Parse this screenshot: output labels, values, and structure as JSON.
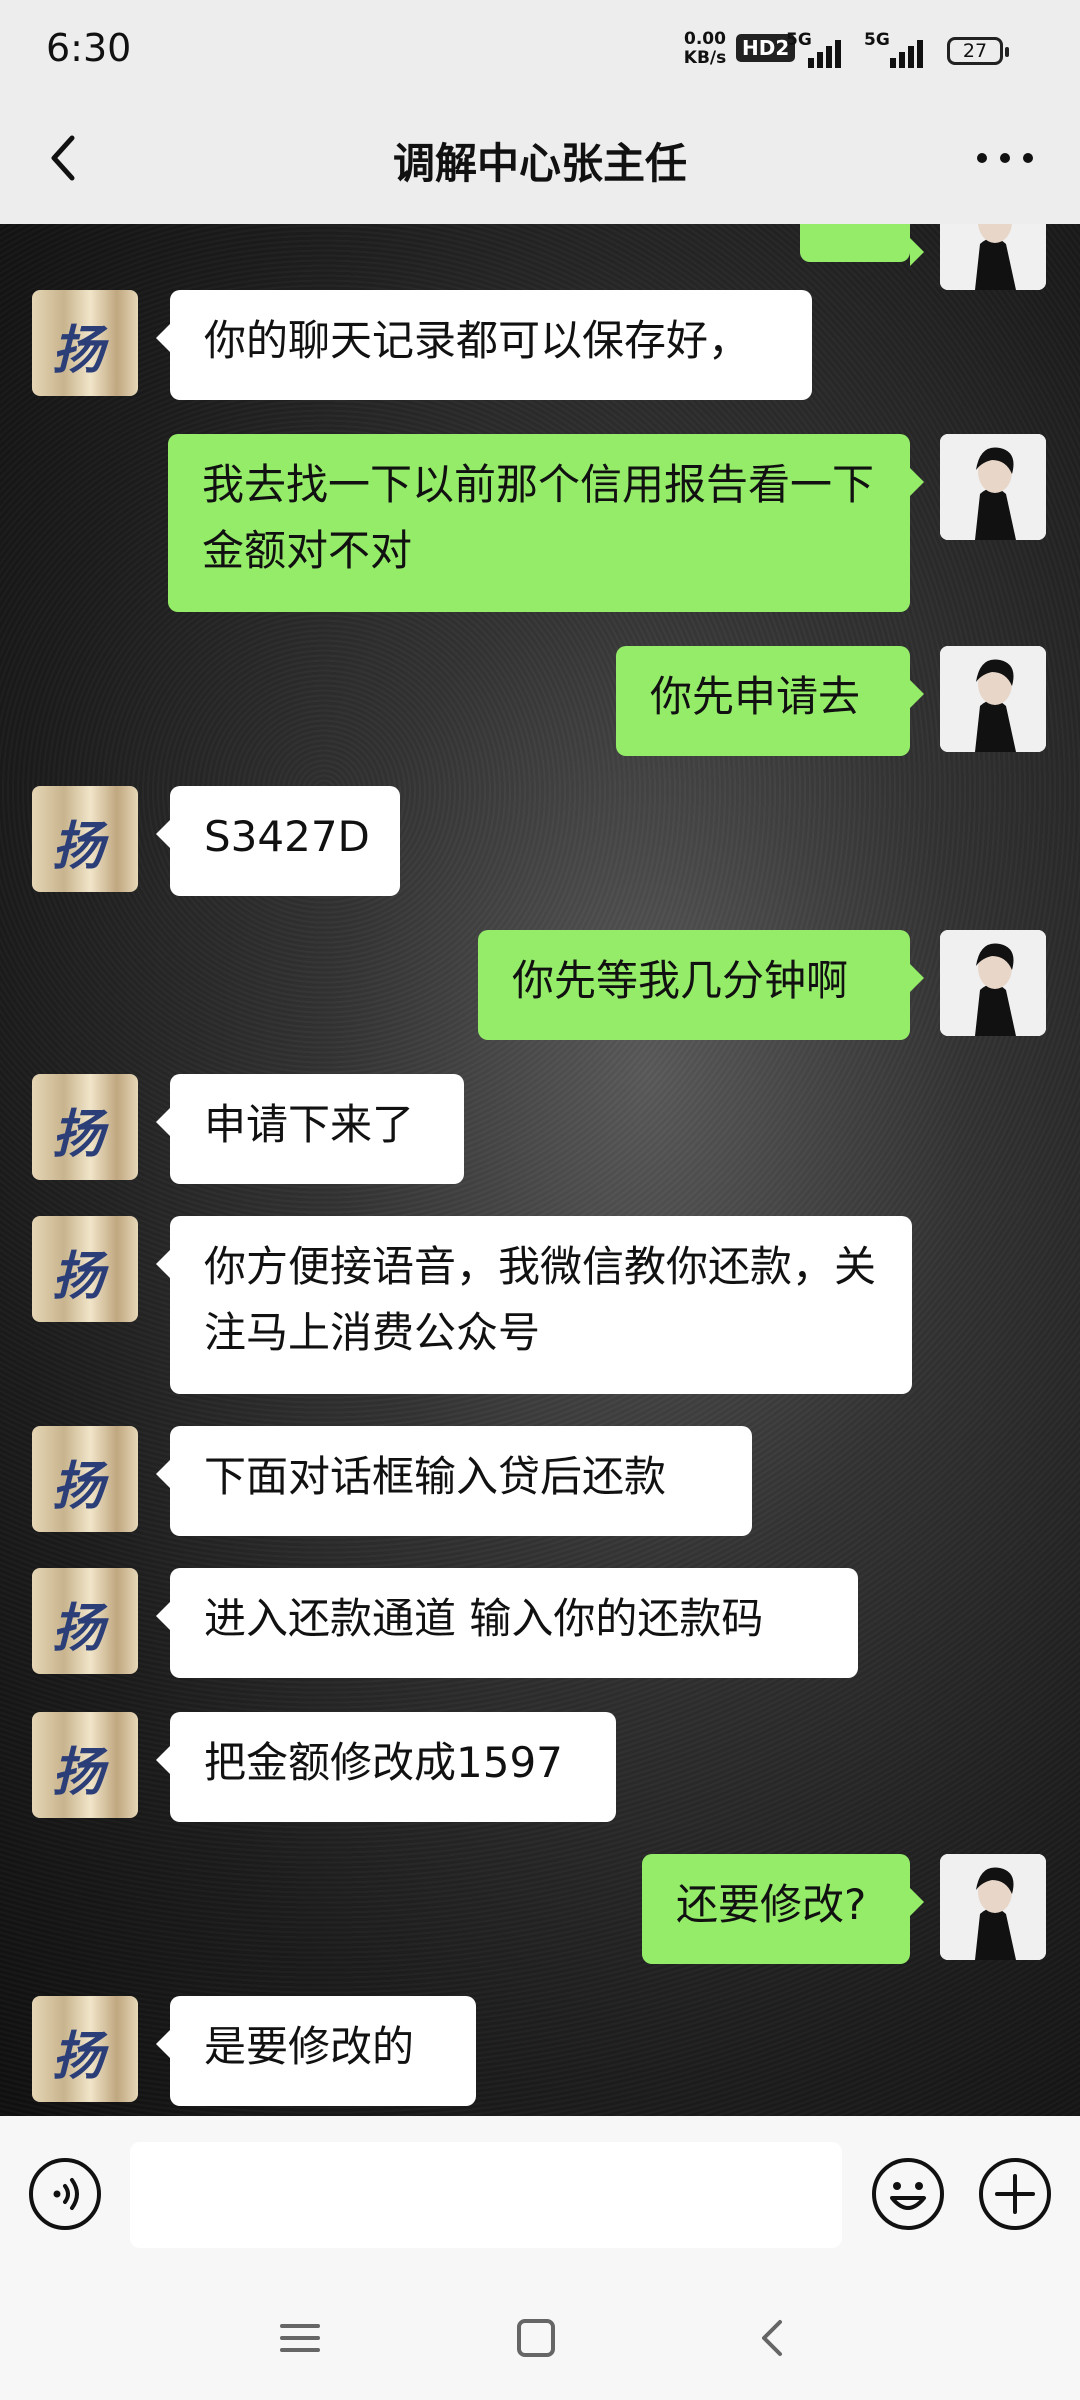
{
  "status_bar": {
    "time": "6:30",
    "net_speed_value": "0.00",
    "net_speed_unit": "KB/s",
    "hd_label": "HD2",
    "signal1_label": "5G",
    "signal2_label": "5G",
    "battery": "27"
  },
  "header": {
    "title": "调解中心张主任"
  },
  "messages": [
    {
      "side": "left",
      "text": "你的聊天记录都可以保存好，"
    },
    {
      "side": "right",
      "text": "我去找一下以前那个信用报告看一下金额对不对"
    },
    {
      "side": "right",
      "text": "你先申请去"
    },
    {
      "side": "left",
      "text": "S3427D"
    },
    {
      "side": "right",
      "text": "你先等我几分钟啊"
    },
    {
      "side": "left",
      "text": "申请下来了"
    },
    {
      "side": "left",
      "text": "你方便接语音，我微信教你还款，关注马上消费公众号"
    },
    {
      "side": "left",
      "text": "下面对话框输入贷后还款"
    },
    {
      "side": "left",
      "text": "进入还款通道 输入你的还款码"
    },
    {
      "side": "left",
      "text": "把金额修改成1597"
    },
    {
      "side": "right",
      "text": "还要修改?"
    },
    {
      "side": "left",
      "text": "是要修改的"
    }
  ],
  "input": {
    "value": ""
  },
  "avatars": {
    "other_glyph": "扬"
  },
  "colors": {
    "bubble_mine": "#95ec69",
    "bubble_other": "#ffffff",
    "header_bg": "#ededed"
  },
  "icons": [
    "back-arrow-icon",
    "more-dots-icon",
    "voice-icon",
    "emoji-icon",
    "plus-icon",
    "menu-icon",
    "home-square-icon",
    "nav-back-icon"
  ]
}
